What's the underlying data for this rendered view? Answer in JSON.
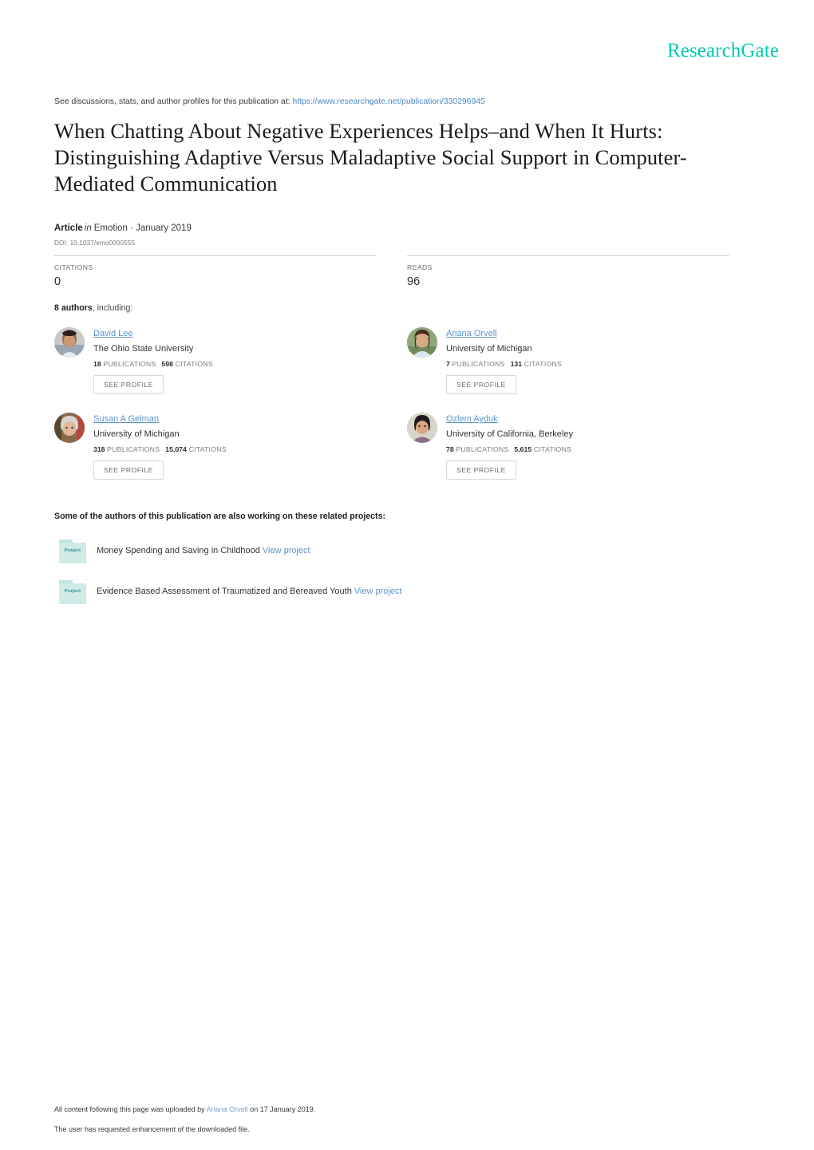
{
  "brand": {
    "logo_text": "ResearchGate",
    "logo_color": "#00ccb1"
  },
  "discussion": {
    "prefix": "See discussions, stats, and author profiles for this publication at:",
    "url": "https://www.researchgate.net/publication/330296945"
  },
  "publication": {
    "title": "When Chatting About Negative Experiences Helps–and When It Hurts: Distinguishing Adaptive Versus Maladaptive Social Support in Computer-Mediated Communication",
    "type": "Article",
    "in_word": "in",
    "venue": "Emotion · January 2019",
    "doi": "DOI: 10.1037/emo0000555"
  },
  "stats": [
    {
      "label": "CITATIONS",
      "value": "0"
    },
    {
      "label": "READS",
      "value": "96"
    }
  ],
  "authors_heading": {
    "count": "8 authors",
    "suffix": ", including:"
  },
  "authors": [
    {
      "name": "David Lee",
      "affiliation": "The Ohio State University",
      "publications": "18",
      "publications_label": "PUBLICATIONS",
      "citations": "598",
      "citations_label": "CITATIONS",
      "profile_button": "SEE PROFILE"
    },
    {
      "name": "Ariana Orvell",
      "affiliation": "University of Michigan",
      "publications": "7",
      "publications_label": "PUBLICATIONS",
      "citations": "131",
      "citations_label": "CITATIONS",
      "profile_button": "SEE PROFILE"
    },
    {
      "name": "Susan A Gelman",
      "affiliation": "University of Michigan",
      "publications": "318",
      "publications_label": "PUBLICATIONS",
      "citations": "15,074",
      "citations_label": "CITATIONS",
      "profile_button": "SEE PROFILE"
    },
    {
      "name": "Ozlem Ayduk",
      "affiliation": "University of California, Berkeley",
      "publications": "78",
      "publications_label": "PUBLICATIONS",
      "citations": "5,615",
      "citations_label": "CITATIONS",
      "profile_button": "SEE PROFILE"
    }
  ],
  "projects_heading": "Some of the authors of this publication are also working on these related projects:",
  "projects": [
    {
      "icon_label": "Project",
      "title": "Money Spending and Saving in Childhood",
      "link_text": "View project"
    },
    {
      "icon_label": "Project",
      "title": "Evidence Based Assessment of Traumatized and Bereaved Youth",
      "link_text": "View project"
    }
  ],
  "footer": {
    "upload_prefix": "All content following this page was uploaded by",
    "upload_author": "Ariana Orvell",
    "upload_suffix": "on 17 January 2019.",
    "enhancement_note": "The user has requested enhancement of the downloaded file."
  }
}
